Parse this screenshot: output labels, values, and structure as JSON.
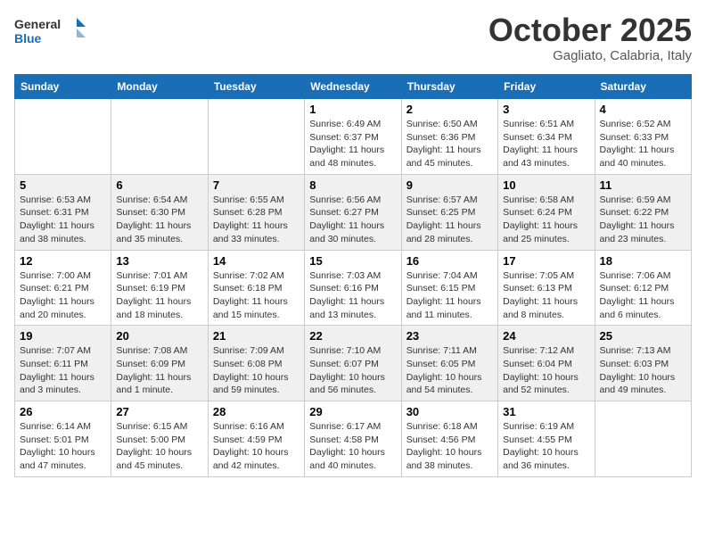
{
  "header": {
    "logo_general": "General",
    "logo_blue": "Blue",
    "month": "October 2025",
    "location": "Gagliato, Calabria, Italy"
  },
  "days_of_week": [
    "Sunday",
    "Monday",
    "Tuesday",
    "Wednesday",
    "Thursday",
    "Friday",
    "Saturday"
  ],
  "weeks": [
    {
      "shade": false,
      "cells": [
        {
          "day": "",
          "content": ""
        },
        {
          "day": "",
          "content": ""
        },
        {
          "day": "",
          "content": ""
        },
        {
          "day": "1",
          "content": "Sunrise: 6:49 AM\nSunset: 6:37 PM\nDaylight: 11 hours\nand 48 minutes."
        },
        {
          "day": "2",
          "content": "Sunrise: 6:50 AM\nSunset: 6:36 PM\nDaylight: 11 hours\nand 45 minutes."
        },
        {
          "day": "3",
          "content": "Sunrise: 6:51 AM\nSunset: 6:34 PM\nDaylight: 11 hours\nand 43 minutes."
        },
        {
          "day": "4",
          "content": "Sunrise: 6:52 AM\nSunset: 6:33 PM\nDaylight: 11 hours\nand 40 minutes."
        }
      ]
    },
    {
      "shade": true,
      "cells": [
        {
          "day": "5",
          "content": "Sunrise: 6:53 AM\nSunset: 6:31 PM\nDaylight: 11 hours\nand 38 minutes."
        },
        {
          "day": "6",
          "content": "Sunrise: 6:54 AM\nSunset: 6:30 PM\nDaylight: 11 hours\nand 35 minutes."
        },
        {
          "day": "7",
          "content": "Sunrise: 6:55 AM\nSunset: 6:28 PM\nDaylight: 11 hours\nand 33 minutes."
        },
        {
          "day": "8",
          "content": "Sunrise: 6:56 AM\nSunset: 6:27 PM\nDaylight: 11 hours\nand 30 minutes."
        },
        {
          "day": "9",
          "content": "Sunrise: 6:57 AM\nSunset: 6:25 PM\nDaylight: 11 hours\nand 28 minutes."
        },
        {
          "day": "10",
          "content": "Sunrise: 6:58 AM\nSunset: 6:24 PM\nDaylight: 11 hours\nand 25 minutes."
        },
        {
          "day": "11",
          "content": "Sunrise: 6:59 AM\nSunset: 6:22 PM\nDaylight: 11 hours\nand 23 minutes."
        }
      ]
    },
    {
      "shade": false,
      "cells": [
        {
          "day": "12",
          "content": "Sunrise: 7:00 AM\nSunset: 6:21 PM\nDaylight: 11 hours\nand 20 minutes."
        },
        {
          "day": "13",
          "content": "Sunrise: 7:01 AM\nSunset: 6:19 PM\nDaylight: 11 hours\nand 18 minutes."
        },
        {
          "day": "14",
          "content": "Sunrise: 7:02 AM\nSunset: 6:18 PM\nDaylight: 11 hours\nand 15 minutes."
        },
        {
          "day": "15",
          "content": "Sunrise: 7:03 AM\nSunset: 6:16 PM\nDaylight: 11 hours\nand 13 minutes."
        },
        {
          "day": "16",
          "content": "Sunrise: 7:04 AM\nSunset: 6:15 PM\nDaylight: 11 hours\nand 11 minutes."
        },
        {
          "day": "17",
          "content": "Sunrise: 7:05 AM\nSunset: 6:13 PM\nDaylight: 11 hours\nand 8 minutes."
        },
        {
          "day": "18",
          "content": "Sunrise: 7:06 AM\nSunset: 6:12 PM\nDaylight: 11 hours\nand 6 minutes."
        }
      ]
    },
    {
      "shade": true,
      "cells": [
        {
          "day": "19",
          "content": "Sunrise: 7:07 AM\nSunset: 6:11 PM\nDaylight: 11 hours\nand 3 minutes."
        },
        {
          "day": "20",
          "content": "Sunrise: 7:08 AM\nSunset: 6:09 PM\nDaylight: 11 hours\nand 1 minute."
        },
        {
          "day": "21",
          "content": "Sunrise: 7:09 AM\nSunset: 6:08 PM\nDaylight: 10 hours\nand 59 minutes."
        },
        {
          "day": "22",
          "content": "Sunrise: 7:10 AM\nSunset: 6:07 PM\nDaylight: 10 hours\nand 56 minutes."
        },
        {
          "day": "23",
          "content": "Sunrise: 7:11 AM\nSunset: 6:05 PM\nDaylight: 10 hours\nand 54 minutes."
        },
        {
          "day": "24",
          "content": "Sunrise: 7:12 AM\nSunset: 6:04 PM\nDaylight: 10 hours\nand 52 minutes."
        },
        {
          "day": "25",
          "content": "Sunrise: 7:13 AM\nSunset: 6:03 PM\nDaylight: 10 hours\nand 49 minutes."
        }
      ]
    },
    {
      "shade": false,
      "cells": [
        {
          "day": "26",
          "content": "Sunrise: 6:14 AM\nSunset: 5:01 PM\nDaylight: 10 hours\nand 47 minutes."
        },
        {
          "day": "27",
          "content": "Sunrise: 6:15 AM\nSunset: 5:00 PM\nDaylight: 10 hours\nand 45 minutes."
        },
        {
          "day": "28",
          "content": "Sunrise: 6:16 AM\nSunset: 4:59 PM\nDaylight: 10 hours\nand 42 minutes."
        },
        {
          "day": "29",
          "content": "Sunrise: 6:17 AM\nSunset: 4:58 PM\nDaylight: 10 hours\nand 40 minutes."
        },
        {
          "day": "30",
          "content": "Sunrise: 6:18 AM\nSunset: 4:56 PM\nDaylight: 10 hours\nand 38 minutes."
        },
        {
          "day": "31",
          "content": "Sunrise: 6:19 AM\nSunset: 4:55 PM\nDaylight: 10 hours\nand 36 minutes."
        },
        {
          "day": "",
          "content": ""
        }
      ]
    }
  ]
}
